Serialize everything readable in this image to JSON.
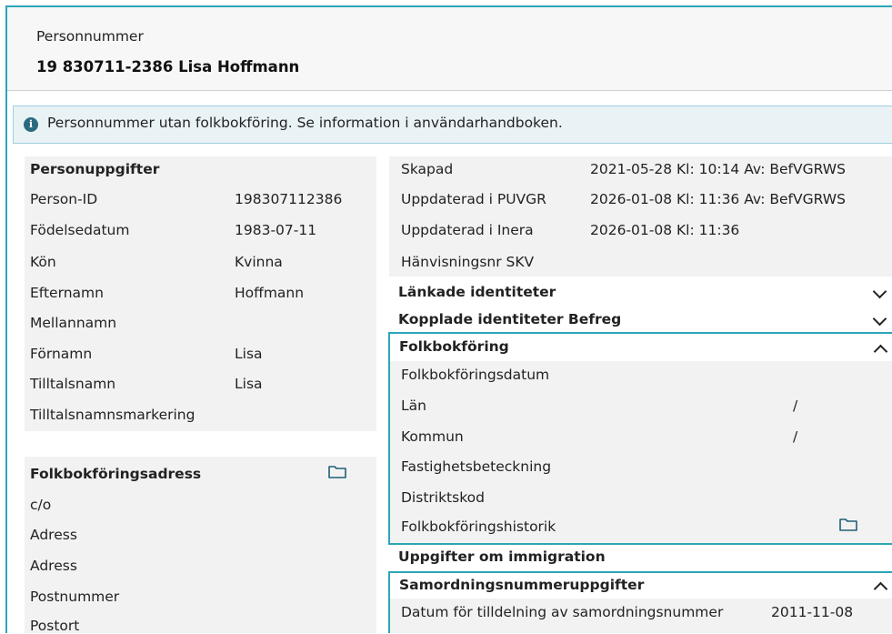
{
  "header": {
    "label": "Personnummer",
    "value": "19 830711-2386 Lisa Hoffmann"
  },
  "info": {
    "text": "Personnummer utan folkbokföring. Se information i användarhandboken.",
    "icon": "info-icon"
  },
  "personuppgifter": {
    "title": "Personuppgifter",
    "rows": [
      {
        "label": "Person-ID",
        "value": "198307112386"
      },
      {
        "label": "Födelsedatum",
        "value": "1983-07-11"
      },
      {
        "label": "Kön",
        "value": "Kvinna"
      },
      {
        "label": "Efternamn",
        "value": "Hoffmann"
      },
      {
        "label": "Mellannamn",
        "value": ""
      },
      {
        "label": "Förnamn",
        "value": "Lisa"
      },
      {
        "label": "Tilltalsnamn",
        "value": "Lisa"
      },
      {
        "label": "Tilltalsnamnsmarkering",
        "value": ""
      }
    ]
  },
  "adress": {
    "title": "Folkbokföringsadress",
    "icon": "folder-icon",
    "rows": [
      "c/o",
      "Adress",
      "Adress",
      "Postnummer",
      "Postort"
    ]
  },
  "meta": {
    "rows": [
      {
        "label": "Skapad",
        "value": "2021-05-28 Kl: 10:14 Av: BefVGRWS"
      },
      {
        "label": "Uppdaterad i PUVGR",
        "value": "2026-01-08 Kl: 11:36 Av: BefVGRWS"
      },
      {
        "label": "Uppdaterad i Inera",
        "value": "2026-01-08 Kl: 11:36"
      },
      {
        "label": "Hänvisningsnr SKV",
        "value": ""
      }
    ]
  },
  "sections": {
    "lankade": "Länkade identiteter",
    "kopplade": "Kopplade identiteter Befreg",
    "immigration": "Uppgifter om immigration"
  },
  "folkbokforing": {
    "title": "Folkbokföring",
    "rows": [
      {
        "label": "Folkbokföringsdatum",
        "value": ""
      },
      {
        "label": "Län",
        "value": "/"
      },
      {
        "label": "Kommun",
        "value": "/"
      },
      {
        "label": "Fastighetsbeteckning",
        "value": ""
      },
      {
        "label": "Distriktskod",
        "value": ""
      },
      {
        "label": "Folkbokföringshistorik",
        "value": ""
      }
    ]
  },
  "samordning": {
    "title": "Samordningsnummeruppgifter",
    "rows": [
      {
        "label": "Datum för tilldelning av samordningsnummer",
        "value": "2011-11-08"
      }
    ]
  }
}
